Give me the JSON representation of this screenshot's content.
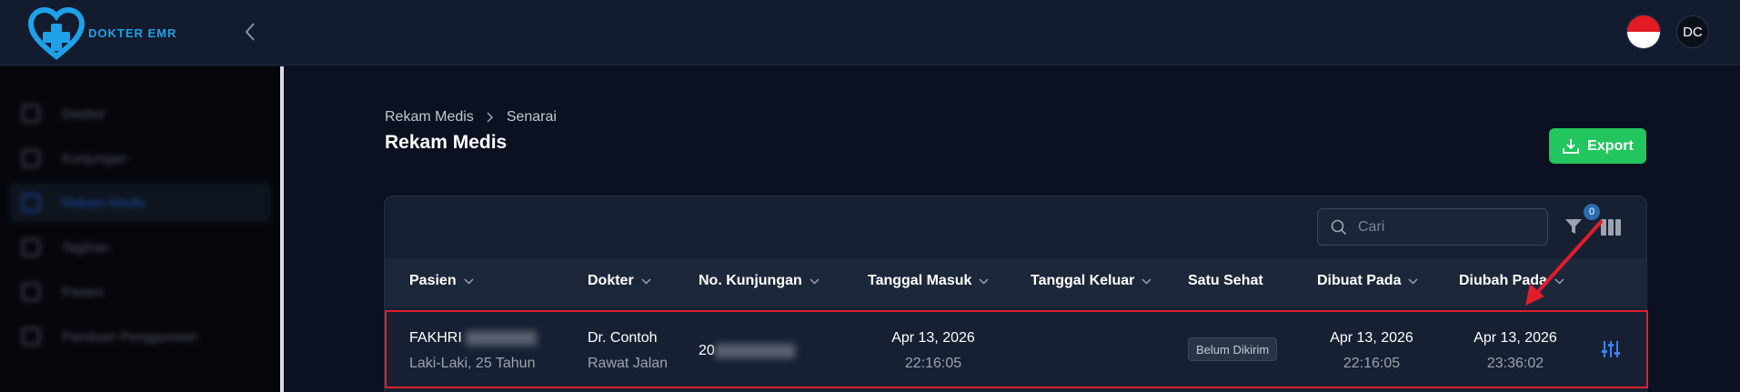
{
  "app": {
    "logo_text": "DOKTER EMR",
    "brand_color": "#1ea1e8"
  },
  "header": {
    "avatar_initials": "DC",
    "flag": "indonesia-flag"
  },
  "sidebar": {
    "items": [
      {
        "label": "Dasbor",
        "icon": "home-icon"
      },
      {
        "label": "Kunjungan",
        "icon": "calendar-icon"
      },
      {
        "label": "Rekam Medis",
        "icon": "document-icon",
        "active": true
      },
      {
        "label": "Tagihan",
        "icon": "invoice-icon"
      },
      {
        "label": "Pasien",
        "icon": "user-icon"
      },
      {
        "label": "Panduan Penggunaan",
        "icon": "book-icon"
      }
    ]
  },
  "breadcrumb": {
    "items": [
      "Rekam Medis",
      "Senarai"
    ]
  },
  "page": {
    "title": "Rekam Medis",
    "export_label": "Export"
  },
  "toolbar": {
    "search_placeholder": "Cari",
    "filter_count": "0"
  },
  "table": {
    "columns": [
      "Pasien",
      "Dokter",
      "No. Kunjungan",
      "Tanggal Masuk",
      "Tanggal Keluar",
      "Satu Sehat",
      "Dibuat Pada",
      "Diubah Pada"
    ],
    "rows": [
      {
        "patient_name": "FAKHRI",
        "patient_detail": "Laki-Laki, 25 Tahun",
        "doctor": "Dr. Contoh",
        "visit_type": "Rawat Jalan",
        "visit_number": "20",
        "date_in": "Apr 13, 2026",
        "time_in": "22:16:05",
        "date_out": "",
        "satu_sehat": "Belum Dikirim",
        "created_date": "Apr 13, 2026",
        "created_time": "22:16:05",
        "updated_date": "Apr 13, 2026",
        "updated_time": "23:36:02"
      }
    ]
  },
  "colors": {
    "accent_green": "#22c55e",
    "highlight_red": "#e11d2a"
  }
}
